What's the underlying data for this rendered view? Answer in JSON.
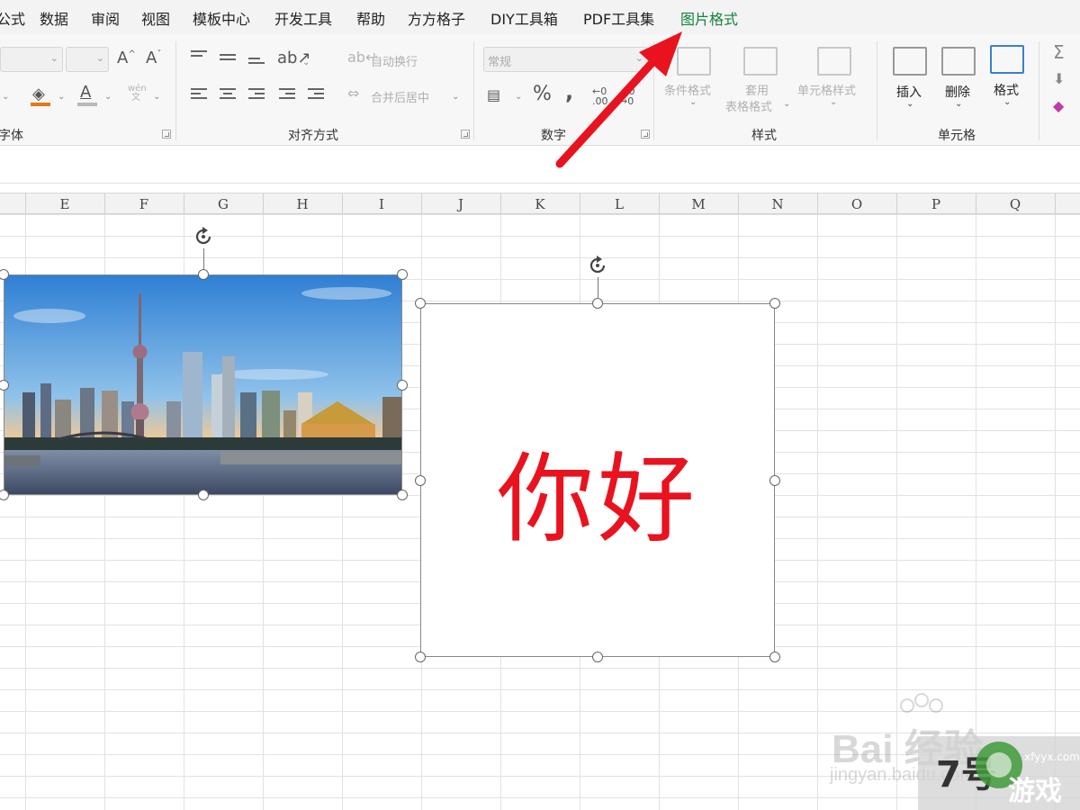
{
  "menu": {
    "items": [
      "公式",
      "数据",
      "审阅",
      "视图",
      "模板中心",
      "开发工具",
      "帮助",
      "方方格子",
      "DIY工具箱",
      "PDF工具集",
      "图片格式"
    ],
    "active_index": 10,
    "active_color": "#14823b"
  },
  "ribbon": {
    "groups": {
      "font": {
        "label": "字体"
      },
      "align": {
        "label": "对齐方式",
        "wrap": "自动换行",
        "merge": "合并后居中"
      },
      "number": {
        "label": "数字",
        "format_placeholder": "常规",
        "percent": "%",
        "comma": ","
      },
      "style": {
        "label": "样式",
        "conditional": "条件格式",
        "table_format_1": "套用",
        "table_format_2": "表格格式",
        "cell_style": "单元格样式"
      },
      "cells": {
        "label": "单元格",
        "insert": "插入",
        "delete": "删除",
        "format": "格式"
      }
    },
    "font_icons": {
      "grow": "A^",
      "shrink": "A˅",
      "font_color": "A",
      "phonetic_top": "wén",
      "phonetic_bottom": "文"
    }
  },
  "sheet": {
    "columns": [
      "E",
      "F",
      "G",
      "H",
      "I",
      "J",
      "K",
      "L",
      "M",
      "N",
      "O",
      "P",
      "Q"
    ]
  },
  "objects": {
    "textbox_text": "你好",
    "textbox_color": "#e8131f"
  },
  "annotation": {
    "arrow_color": "#e8131f"
  },
  "watermarks": {
    "baidu": "Bai 经验",
    "baidu_sub": "jingyan.baidu.com",
    "game_num": "7号",
    "game_text": "游戏",
    "game_url": "xfyyx.com"
  }
}
